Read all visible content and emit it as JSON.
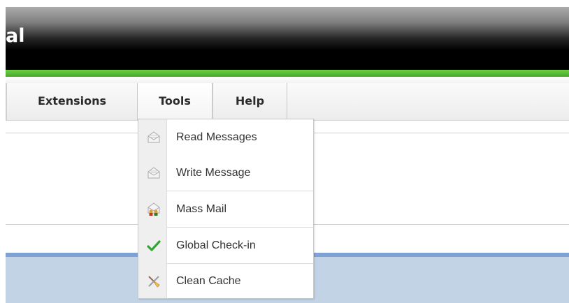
{
  "header": {
    "title": "al"
  },
  "menubar": {
    "items": [
      {
        "label": "Extensions"
      },
      {
        "label": "Tools"
      },
      {
        "label": "Help"
      }
    ]
  },
  "tools_menu": {
    "items": [
      {
        "label": "Read Messages",
        "icon": "envelope-icon"
      },
      {
        "label": "Write Message",
        "icon": "envelope-icon"
      },
      {
        "label": "Mass Mail",
        "icon": "mass-mail-icon"
      },
      {
        "label": "Global Check-in",
        "icon": "checkmark-icon"
      },
      {
        "label": "Clean Cache",
        "icon": "broom-icon"
      }
    ]
  },
  "colors": {
    "accent_green": "#46a92a",
    "header_black": "#000000",
    "panel_blue": "#c3d3e6"
  }
}
